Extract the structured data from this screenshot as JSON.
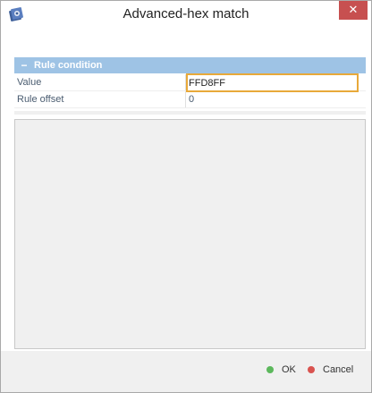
{
  "window": {
    "title": "Advanced-hex match",
    "close_glyph": "✕"
  },
  "icons": {
    "app": "app-logo-icon",
    "close": "close-icon",
    "collapse": "minus-icon"
  },
  "group": {
    "collapse_glyph": "−",
    "title": "Rule condition"
  },
  "properties": [
    {
      "label": "Value",
      "value": "FFD8FF"
    },
    {
      "label": "Rule offset",
      "value": "0"
    }
  ],
  "buttons": {
    "ok_label": "OK",
    "cancel_label": "Cancel"
  },
  "colors": {
    "header_bg": "#9ec3e5",
    "close_bg": "#c75050",
    "ok_dot": "#5cb85c",
    "cancel_dot": "#d9534f",
    "input_border": "#e8a93a"
  }
}
